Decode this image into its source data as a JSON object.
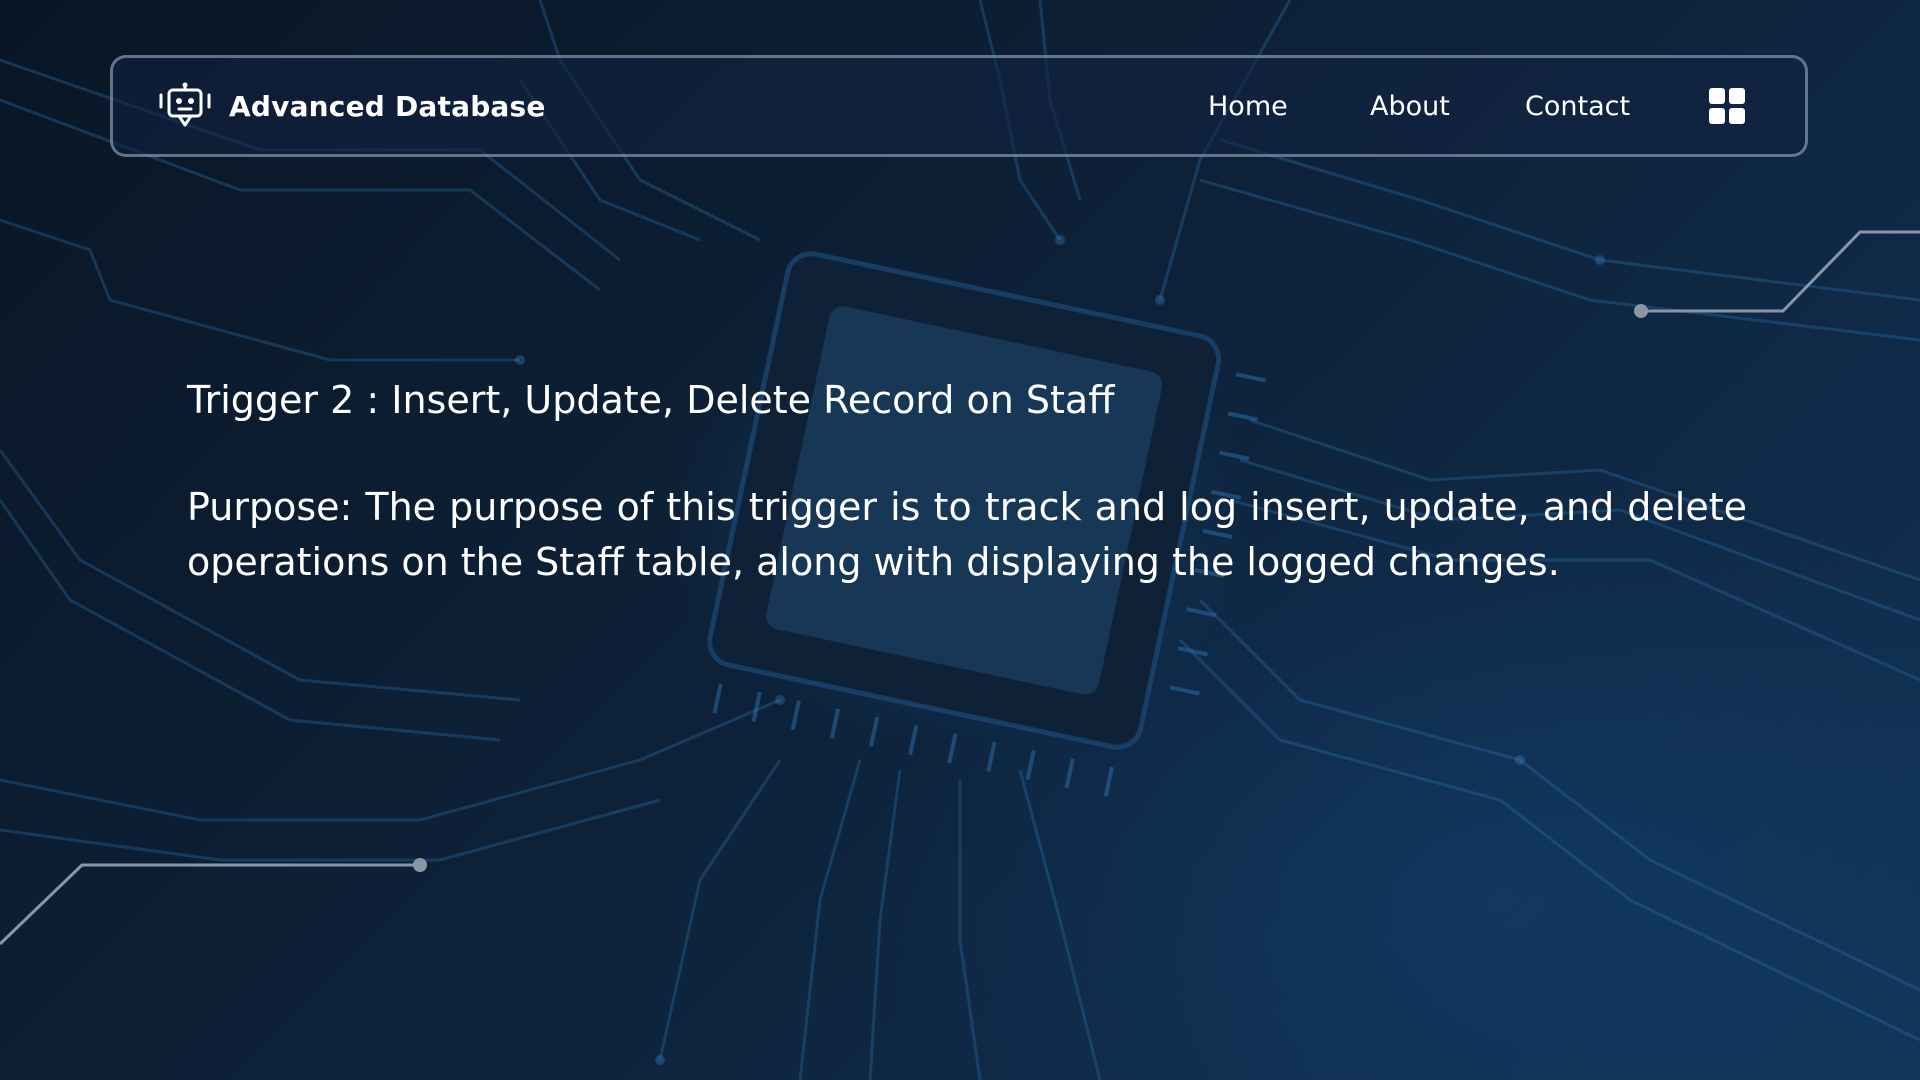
{
  "brand": {
    "name": "Advanced Database",
    "icon": "robot-icon"
  },
  "nav": {
    "home_label": "Home",
    "about_label": "About",
    "contact_label": "Contact",
    "menu_icon": "grid-menu-icon"
  },
  "main": {
    "heading": "Trigger 2 : Insert, Update, Delete Record on Staff",
    "purpose": "Purpose: The purpose of this trigger is to track and log insert, update, and delete operations on the Staff table, along with displaying the logged changes."
  },
  "colors": {
    "background": "#0d2138",
    "accent": "#2a7fc0",
    "text": "#ffffff",
    "nav_border": "#aab9cd"
  }
}
